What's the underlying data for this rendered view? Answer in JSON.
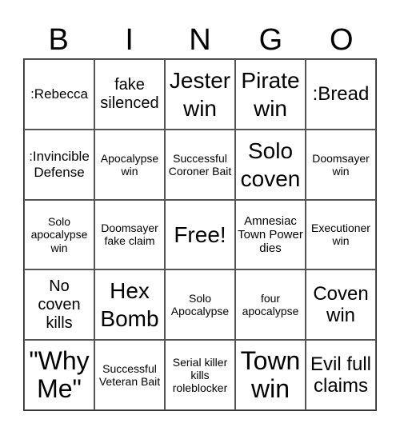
{
  "header": [
    "B",
    "I",
    "N",
    "G",
    "O"
  ],
  "cells": [
    [
      ":Rebecca",
      "fake silenced",
      "Jester win",
      "Pirate win",
      ":Bread"
    ],
    [
      ":Invincible Defense",
      "Apocalypse win",
      "Successful Coroner Bait",
      "Solo coven",
      "Doomsayer win"
    ],
    [
      "Solo apocalypse win",
      "Doomsayer fake claim",
      "Free!",
      "Amnesiac Town Power dies",
      "Executioner win"
    ],
    [
      "No coven kills",
      "Hex Bomb",
      "Solo Apocalypse",
      "four apocalypse",
      "Coven win"
    ],
    [
      "\"Why Me\"",
      "Successful Veteran Bait",
      "Serial killer kills roleblocker",
      "Town win",
      "Evil full claims"
    ]
  ]
}
